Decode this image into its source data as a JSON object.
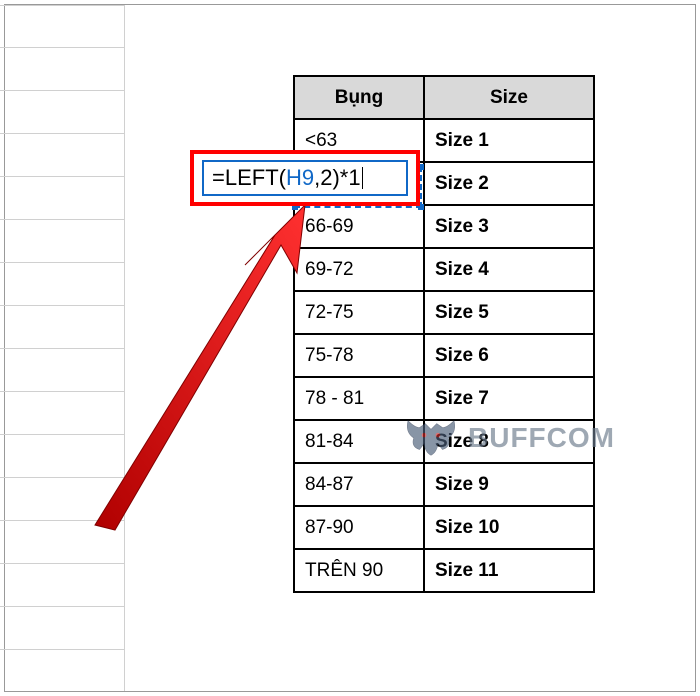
{
  "formula": {
    "prefix": "=LEFT(",
    "cell_ref": "H9",
    "suffix": ",2)*1"
  },
  "table": {
    "headers": {
      "col1": "Bụng",
      "col2": "Size"
    },
    "rows": [
      {
        "bung": "<63",
        "size": "Size 1"
      },
      {
        "bung": "",
        "size": "Size 2"
      },
      {
        "bung": "66-69",
        "size": "Size 3"
      },
      {
        "bung": "69-72",
        "size": "Size 4"
      },
      {
        "bung": "72-75",
        "size": "Size 5"
      },
      {
        "bung": "75-78",
        "size": "Size 6"
      },
      {
        "bung": "78 - 81",
        "size": "Size 7"
      },
      {
        "bung": "81-84",
        "size": "Size 8"
      },
      {
        "bung": "84-87",
        "size": "Size 9"
      },
      {
        "bung": "87-90",
        "size": "Size 10"
      },
      {
        "bung": "TRÊN 90",
        "size": "Size 11"
      }
    ]
  },
  "watermark": {
    "text": "BUFFCOM"
  },
  "colors": {
    "highlight_red": "#ff0000",
    "cell_ref_blue": "#1068c7",
    "header_grey": "#d9d9d9"
  }
}
